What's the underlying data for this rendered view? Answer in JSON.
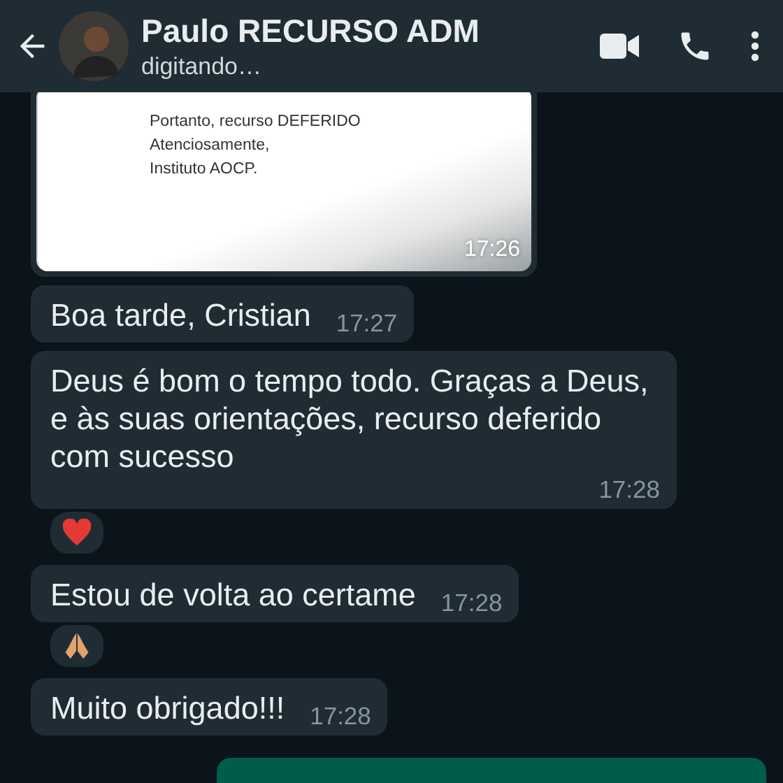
{
  "header": {
    "contact_name": "Paulo RECURSO ADM",
    "status": "digitando…"
  },
  "document_message": {
    "lines": [
      "Portanto, recurso DEFERIDO",
      "Atenciosamente,",
      "Instituto AOCP."
    ],
    "time": "17:26"
  },
  "messages": [
    {
      "kind": "incoming",
      "text": "Boa tarde, Cristian",
      "time": "17:27"
    },
    {
      "kind": "incoming",
      "text": "Deus é bom o tempo todo. Graças a Deus, e às suas orientações, recurso deferido com sucesso",
      "time": "17:28",
      "reaction": {
        "kind": "heart"
      }
    },
    {
      "kind": "incoming",
      "text": "Estou de volta ao certame",
      "time": "17:28",
      "reaction": {
        "kind": "pray"
      }
    },
    {
      "kind": "incoming",
      "text": "Muito obrigado!!!",
      "time": "17:28"
    },
    {
      "kind": "outgoing"
    }
  ]
}
